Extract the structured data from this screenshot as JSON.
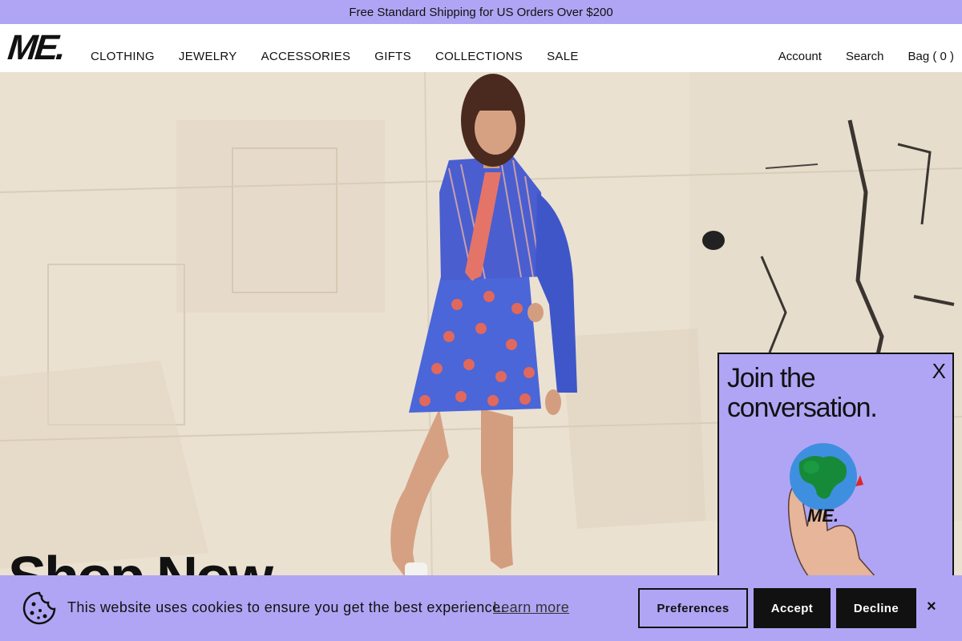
{
  "promo": {
    "text": "Free Standard Shipping for US Orders Over $200"
  },
  "header": {
    "logo": "ME.",
    "nav": [
      "CLOTHING",
      "JEWELRY",
      "ACCESSORIES",
      "GIFTS",
      "COLLECTIONS",
      "SALE"
    ],
    "account": "Account",
    "search": "Search",
    "bag": "Bag ( 0 )"
  },
  "hero": {
    "title": "Shop Now"
  },
  "popup": {
    "title": "Join the conversation.",
    "close": "X",
    "art_logo": "ME."
  },
  "cookie": {
    "message": "This website uses cookies to ensure you get the best experience.",
    "learn_more": "Learn more",
    "preferences": "Preferences",
    "accept": "Accept",
    "decline": "Decline",
    "close": "×"
  },
  "colors": {
    "accent": "#b0a5f4",
    "dark": "#111111"
  }
}
